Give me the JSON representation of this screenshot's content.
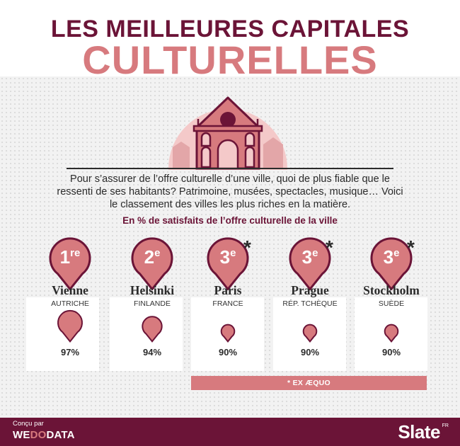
{
  "header": {
    "title_line1": "LES MEILLEURES CAPITALES",
    "title_line2": "CULTURELLES"
  },
  "intro": {
    "text": "Pour s’assurer de l’offre culturelle d’une ville, quoi de plus fiable que le ressenti de ses habitants? Patrimoine, musées, spectacles, musique… Voici le classement des villes les plus riches en la matière.",
    "subtitle": "En % de satisfaits de l’offre culturelle de la ville"
  },
  "colors": {
    "primary": "#6b1437",
    "accent": "#d77a7e",
    "light": "#f4c9c9",
    "background": "#f2f2f2"
  },
  "icons": {
    "illustration": "cathedral-building-icon",
    "rank": "map-pin-icon",
    "value": "map-pin-icon"
  },
  "chart_data": {
    "type": "bar",
    "title": "LES MEILLEURES CAPITALES CULTURELLES",
    "subtitle": "En % de satisfaits de l’offre culturelle de la ville",
    "unit": "%",
    "categories": [
      "Vienne",
      "Helsinki",
      "Paris",
      "Prague",
      "Stockholm"
    ],
    "countries": [
      "AUTRICHE",
      "FINLANDE",
      "FRANCE",
      "RÉP. TCHÈQUE",
      "SUÈDE"
    ],
    "ranks": [
      "1",
      "2",
      "3",
      "3",
      "3"
    ],
    "rank_suffixes": [
      "re",
      "e",
      "e",
      "e",
      "e"
    ],
    "tie_marks": [
      "",
      "",
      "*",
      "*",
      "*"
    ],
    "values": [
      97,
      94,
      90,
      90,
      90
    ],
    "labels": [
      "97%",
      "94%",
      "90%",
      "90%",
      "90%"
    ],
    "annotation": "* EX ÆQUO"
  },
  "footer": {
    "credit_label": "Conçu par",
    "credit_brand_part1": "WE",
    "credit_brand_part2": "DO",
    "credit_brand_part3": "DATA",
    "publisher": "Slate",
    "publisher_edition": "FR"
  }
}
